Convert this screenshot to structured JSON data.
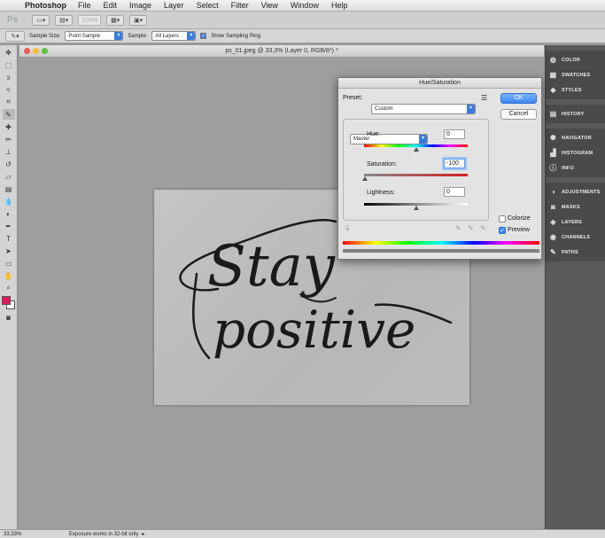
{
  "menubar": {
    "app_name": "Photoshop",
    "items": [
      "File",
      "Edit",
      "Image",
      "Layer",
      "Select",
      "Filter",
      "View",
      "Window",
      "Help"
    ]
  },
  "appbar": {
    "logo": "Ps",
    "zoom": "100%"
  },
  "options": {
    "sample_size_label": "Sample Size:",
    "sample_size_value": "Point Sample",
    "sample_label": "Sample:",
    "sample_value": "All Layers",
    "show_ring_label": "Show Sampling Ring"
  },
  "document": {
    "title": "ps_01.jpeg @ 33,3% (Layer 0, RGB/8*) *"
  },
  "status": {
    "zoom": "33,33%",
    "message": "Exposure works in 32-bit only"
  },
  "panels": {
    "group1": [
      "COLOR",
      "SWATCHES",
      "STYLES"
    ],
    "group2": [
      "HISTORY"
    ],
    "group3": [
      "NAVIGATOR",
      "HISTOGRAM",
      "INFO"
    ],
    "group4": [
      "ADJUSTMENTS",
      "MASKS",
      "LAYERS",
      "CHANNELS",
      "PATHS"
    ]
  },
  "dialog": {
    "title": "Hue/Saturation",
    "preset_label": "Preset:",
    "preset_value": "Custom",
    "channel_value": "Master",
    "hue_label": "Hue:",
    "hue_value": "0",
    "saturation_label": "Saturation:",
    "saturation_value": "-100",
    "lightness_label": "Lightness:",
    "lightness_value": "0",
    "ok_label": "OK",
    "cancel_label": "Cancel",
    "colorize_label": "Colorize",
    "preview_label": "Preview",
    "colorize_checked": false,
    "preview_checked": true
  },
  "artwork": {
    "line1": "Stay",
    "line2": "positive"
  },
  "colors": {
    "foreground": "#e0195a",
    "background": "#ffffff",
    "accent": "#3a7be0"
  }
}
